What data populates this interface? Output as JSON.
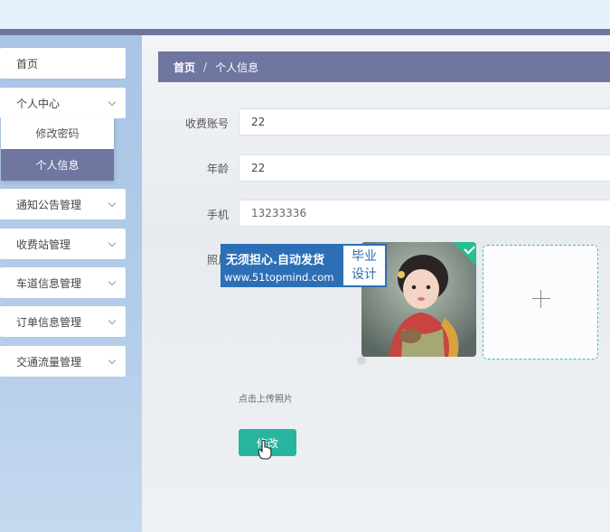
{
  "sidebar": {
    "items": [
      {
        "label": "首页",
        "has_arrow": false
      },
      {
        "label": "个人中心",
        "has_arrow": true
      },
      {
        "label": "通知公告管理",
        "has_arrow": true
      },
      {
        "label": "收费站管理",
        "has_arrow": true
      },
      {
        "label": "车道信息管理",
        "has_arrow": true
      },
      {
        "label": "订单信息管理",
        "has_arrow": true
      },
      {
        "label": "交通流量管理",
        "has_arrow": true
      }
    ],
    "submenu": [
      {
        "label": "修改密码",
        "active": false
      },
      {
        "label": "个人信息",
        "active": true
      }
    ]
  },
  "breadcrumb": {
    "home": "首页",
    "separator": "/",
    "current": "个人信息"
  },
  "form": {
    "account": {
      "label": "收费账号",
      "value": "22"
    },
    "age": {
      "label": "年龄",
      "value": "22"
    },
    "phone": {
      "label": "手机",
      "value": "13233336"
    },
    "photo": {
      "label": "照片",
      "hint": "点击上传照片"
    },
    "submit_label": "修改"
  },
  "watermark": {
    "line1": "无须担心.自动发货",
    "line2": "www.51topmind.com",
    "badge_line1": "毕业",
    "badge_line2": "设计"
  },
  "colors": {
    "accent": "#6f76a0",
    "primary_button": "#27b5a0",
    "success": "#27bf8e"
  }
}
